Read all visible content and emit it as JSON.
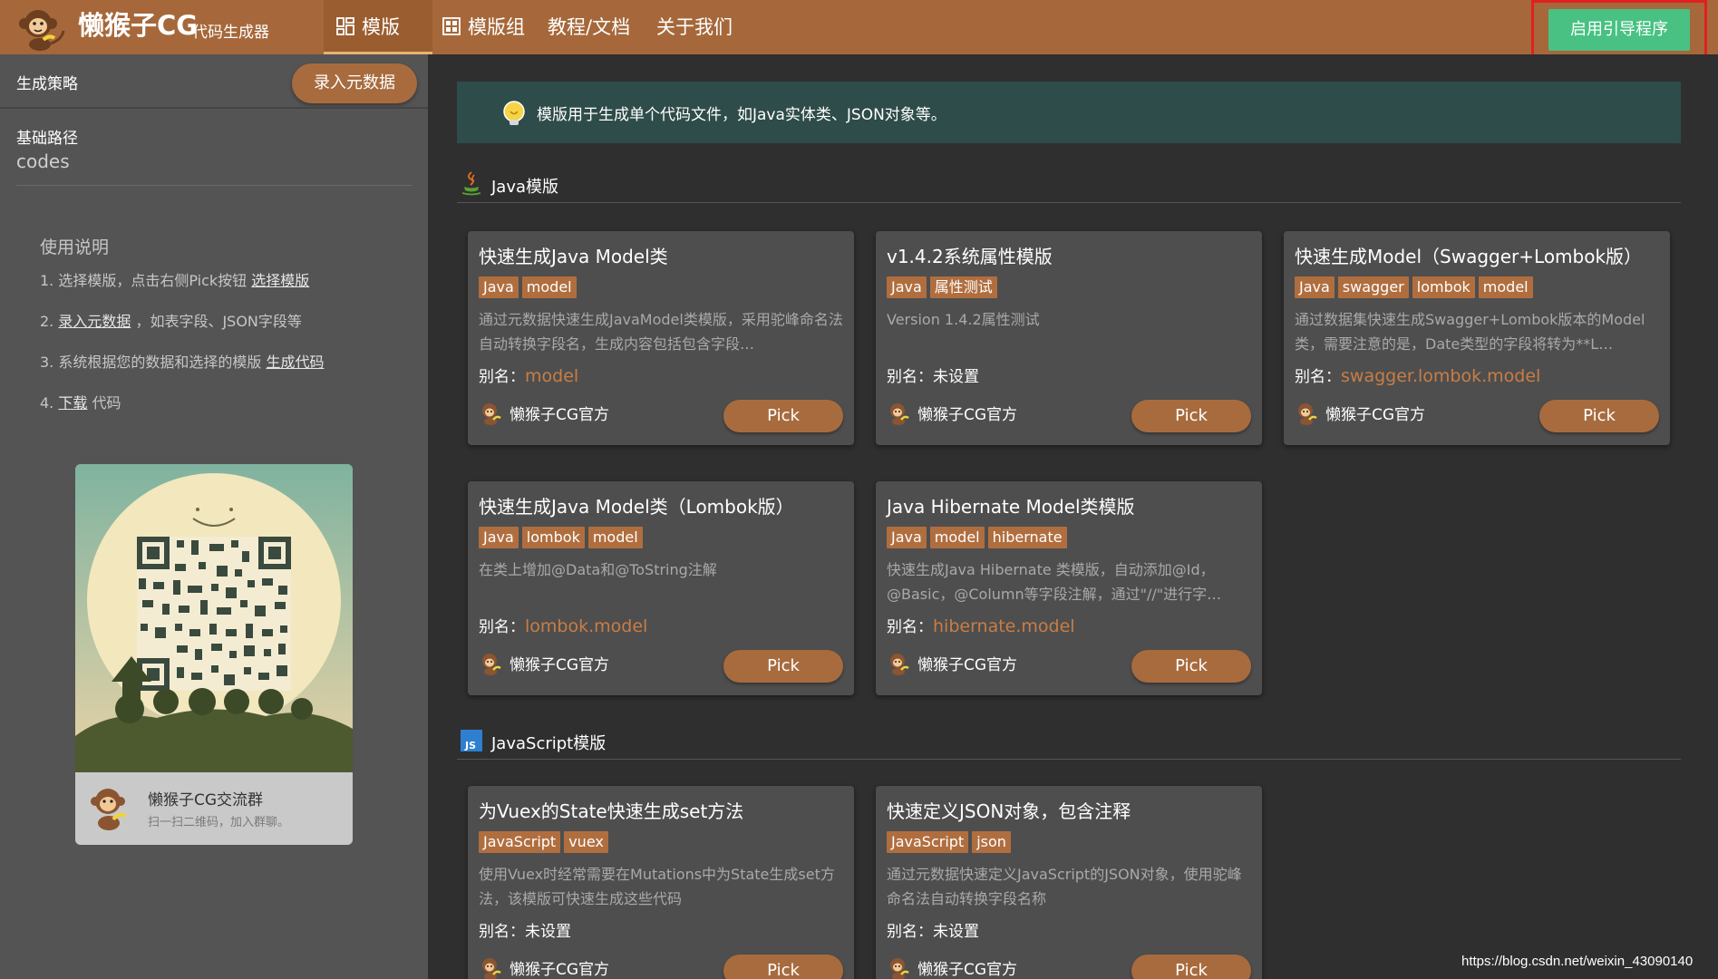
{
  "header": {
    "brand": "懒猴子CG",
    "brand_sub": "代码生成器",
    "nav": [
      {
        "label": "模版",
        "icon": "template-grid-icon",
        "active": true
      },
      {
        "label": "模版组",
        "icon": "template-group-icon",
        "active": false
      },
      {
        "label": "教程/文档",
        "active": false
      },
      {
        "label": "关于我们",
        "active": false
      }
    ],
    "guide_button": "启用引导程序"
  },
  "sidebar": {
    "strategy_label": "生成策略",
    "entry_button": "录入元数据",
    "base_path_label": "基础路径",
    "base_path_value": "codes",
    "usage_title": "使用说明",
    "steps": [
      {
        "prefix": "1. 选择模版，点击右侧Pick按钮 ",
        "link": "选择模版",
        "suffix": ""
      },
      {
        "prefix": "2. ",
        "link": "录入元数据",
        "suffix": " ，如表字段、JSON字段等"
      },
      {
        "prefix": "3. 系统根据您的数据和选择的模版 ",
        "link": "生成代码",
        "suffix": ""
      },
      {
        "prefix": "4. ",
        "link": "下载",
        "suffix": " 代码"
      }
    ],
    "qr": {
      "title": "懒猴子CG交流群",
      "subtitle": "扫一扫二维码，加入群聊。"
    }
  },
  "main": {
    "tip": "模版用于生成单个代码文件，如Java实体类、JSON对象等。",
    "alias_label": "别名：",
    "pick_label": "Pick",
    "sections": [
      {
        "title": "Java模版",
        "icon": "java-cup-icon",
        "cards": [
          {
            "title": "快速生成Java Model类",
            "tags": [
              "Java",
              "model"
            ],
            "desc": "通过元数据快速生成JavaModel类模版，采用驼峰命名法自动转换字段名，生成内容包括包含字段…",
            "alias": "model",
            "author": "懒猴子CG官方"
          },
          {
            "title": "v1.4.2系统属性模版",
            "tags": [
              "Java",
              "属性测试"
            ],
            "desc": "Version 1.4.2属性测试",
            "alias": "未设置",
            "alias_unset": true,
            "author": "懒猴子CG官方"
          },
          {
            "title": "快速生成Model（Swagger+Lombok版）",
            "tags": [
              "Java",
              "swagger",
              "lombok",
              "model"
            ],
            "desc": "通过数据集快速生成Swagger+Lombok版本的Model类，需要注意的是，Date类型的字段将转为**L…",
            "alias": "swagger.lombok.model",
            "author": "懒猴子CG官方"
          },
          {
            "title": "快速生成Java Model类（Lombok版）",
            "tags": [
              "Java",
              "lombok",
              "model"
            ],
            "desc": "在类上增加@Data和@ToString注解",
            "alias": "lombok.model",
            "author": "懒猴子CG官方"
          },
          {
            "title": "Java Hibernate Model类模版",
            "tags": [
              "Java",
              "model",
              "hibernate"
            ],
            "desc": "快速生成Java Hibernate 类模版，自动添加@Id，@Basic，@Column等字段注解，通过\"//\"进行字…",
            "alias": "hibernate.model",
            "author": "懒猴子CG官方"
          }
        ]
      },
      {
        "title": "JavaScript模版",
        "icon": "javascript-icon",
        "cards": [
          {
            "title": "为Vuex的State快速生成set方法",
            "tags": [
              "JavaScript",
              "vuex"
            ],
            "desc": "使用Vuex时经常需要在Mutations中为State生成set方法，该模版可快速生成这些代码",
            "alias": "未设置",
            "alias_unset": true,
            "author": "懒猴子CG官方"
          },
          {
            "title": "快速定义JSON对象，包含注释",
            "tags": [
              "JavaScript",
              "json"
            ],
            "desc": "通过元数据快速定义JavaScript的JSON对象，使用驼峰命名法自动转换字段名称",
            "alias": "未设置",
            "alias_unset": true,
            "author": "懒猴子CG官方"
          }
        ]
      }
    ]
  },
  "watermark": "https://blog.csdn.net/weixin_43090140",
  "colors": {
    "topbar": "#a6683a",
    "accent": "#a86b3e",
    "guide": "#48c182",
    "highlight": "#e02020"
  }
}
